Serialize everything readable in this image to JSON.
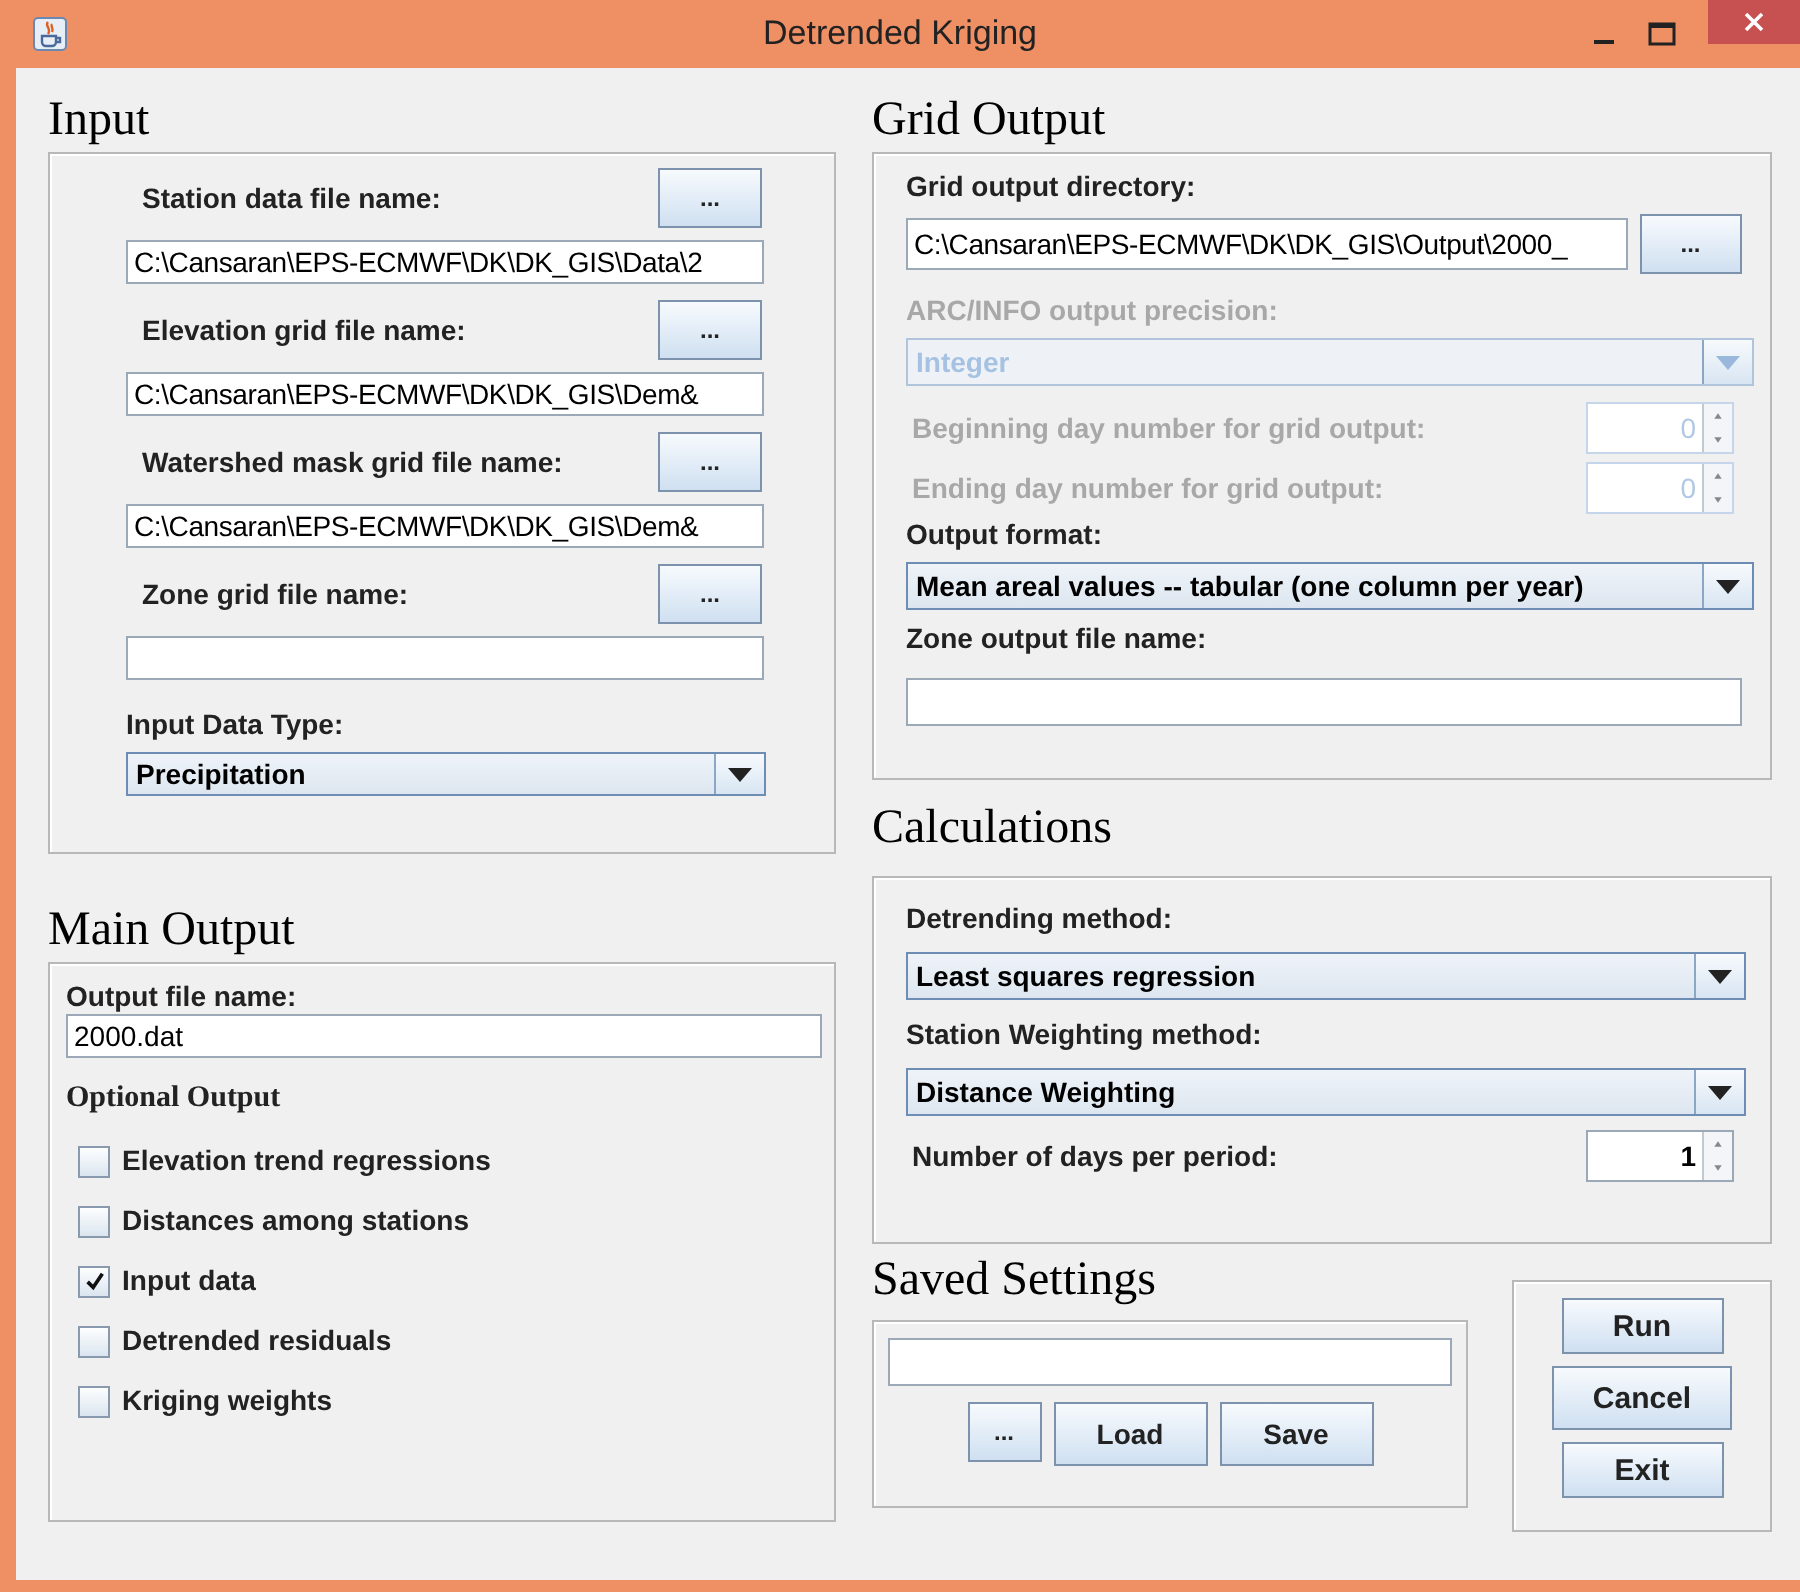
{
  "window": {
    "title": "Detrended Kriging"
  },
  "input": {
    "heading": "Input",
    "files": [
      {
        "label": "Station data file name:",
        "browse": "...",
        "value": "C:\\Cansaran\\EPS-ECMWF\\DK\\DK_GIS\\Data\\2"
      },
      {
        "label": "Elevation grid file name:",
        "browse": "...",
        "value": "C:\\Cansaran\\EPS-ECMWF\\DK\\DK_GIS\\Dem&"
      },
      {
        "label": "Watershed mask grid file name:",
        "browse": "...",
        "value": "C:\\Cansaran\\EPS-ECMWF\\DK\\DK_GIS\\Dem&"
      },
      {
        "label": "Zone grid file name:",
        "browse": "..."
      }
    ],
    "data_type": {
      "label": "Input Data Type:",
      "value": "Precipitation"
    }
  },
  "main_output": {
    "heading": "Main Output",
    "file_label": "Output file name:",
    "file_value": "2000.dat",
    "optional_heading": "Optional Output",
    "options": [
      {
        "label": "Elevation trend regressions",
        "checked": false
      },
      {
        "label": "Distances among stations",
        "checked": false
      },
      {
        "label": "Input data",
        "checked": true
      },
      {
        "label": "Detrended residuals",
        "checked": false
      },
      {
        "label": "Kriging weights",
        "checked": false
      }
    ]
  },
  "grid_output": {
    "heading": "Grid Output",
    "rows": [
      {
        "kind": "browse",
        "label": "Grid output directory:",
        "value": "C:\\Cansaran\\EPS-ECMWF\\DK\\DK_GIS\\Output\\2000_",
        "browse": "...",
        "disabled": false
      },
      {
        "kind": "dropdown",
        "label": "ARC/INFO output precision:",
        "value": "Integer",
        "disabled": true
      },
      {
        "kind": "spinner",
        "label": "Beginning day number for grid output:",
        "value": "0",
        "disabled": true
      },
      {
        "kind": "spinner",
        "label": "Ending day number for grid output:",
        "value": "0",
        "disabled": true
      },
      {
        "kind": "dropdown",
        "label": "Output format:",
        "value": "Mean areal values -- tabular (one column per year)",
        "disabled": false
      },
      {
        "kind": "text",
        "label": "Zone output file name:"
      }
    ]
  },
  "calculations": {
    "heading": "Calculations",
    "rows": [
      {
        "kind": "dropdown",
        "label": "Detrending method:",
        "value": "Least squares regression",
        "disabled": false
      },
      {
        "kind": "dropdown",
        "label": "Station Weighting method:",
        "value": "Distance Weighting",
        "disabled": false
      },
      {
        "kind": "spinner",
        "label": "Number of days per period:",
        "value": "1",
        "disabled": false
      }
    ]
  },
  "saved_settings": {
    "heading": "Saved Settings",
    "buttons": [
      "...",
      "Load",
      "Save"
    ]
  },
  "actions": [
    "Run",
    "Cancel",
    "Exit"
  ]
}
